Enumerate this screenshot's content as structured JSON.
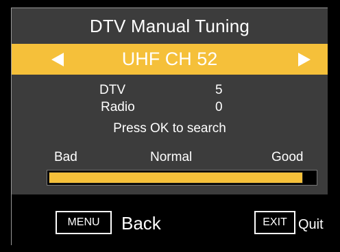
{
  "title": "DTV Manual Tuning",
  "channel": {
    "label": "UHF CH 52",
    "prev_icon": "triangle-left-icon",
    "next_icon": "triangle-right-icon"
  },
  "counts": {
    "dtv_label": "DTV",
    "dtv_value": "5",
    "radio_label": "Radio",
    "radio_value": "0"
  },
  "hint": "Press OK to search",
  "signal": {
    "scale_low": "Bad",
    "scale_mid": "Normal",
    "scale_high": "Good",
    "level_fraction": 0.955
  },
  "footer": {
    "menu_key": "MENU",
    "back_label": "Back",
    "exit_key": "EXIT",
    "quit_label": "Quit"
  },
  "colors": {
    "accent": "#f5c03a",
    "panel": "#3c3c3c",
    "background": "#000000",
    "text": "#ffffff"
  }
}
